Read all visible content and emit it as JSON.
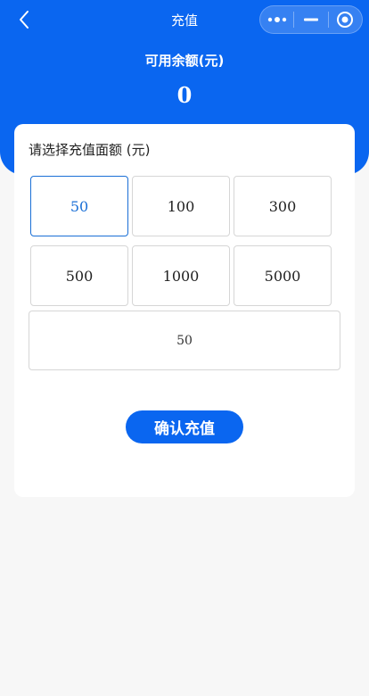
{
  "navbar": {
    "title": "充值",
    "back_icon": "chevron-left-icon",
    "capsule": {
      "more_icon": "more-dots-icon",
      "minimize_icon": "minus-icon",
      "close_icon": "target-circle-icon"
    }
  },
  "balance": {
    "label": "可用余额(元)",
    "value": "0"
  },
  "recharge": {
    "title": "请选择充值面额 (元)",
    "options": [
      "50",
      "100",
      "300",
      "500",
      "1000",
      "5000"
    ],
    "selected": "50",
    "custom_value": "50",
    "confirm_label": "确认充值"
  },
  "colors": {
    "primary": "#0a66f0",
    "selected_border": "#1a6fd6",
    "background": "#f7f7f7"
  }
}
